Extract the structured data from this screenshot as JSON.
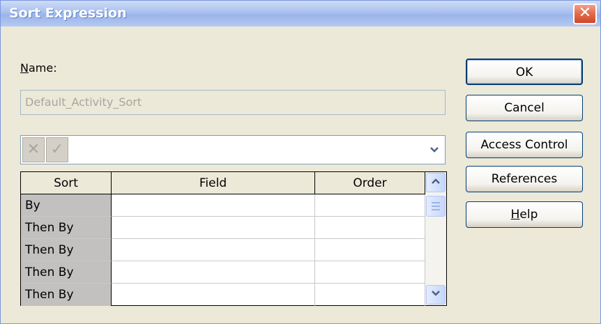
{
  "dialog": {
    "title": "Sort Expression",
    "close_glyph": "✕"
  },
  "name_label": {
    "first_letter": "N",
    "rest": "ame:"
  },
  "name_value": "Default_Activity_Sort",
  "expression_bar": {
    "cancel_icon": "✕",
    "accept_icon": "✓",
    "value": "",
    "dropdown_icon": "chevron-down"
  },
  "grid": {
    "columns": [
      "Sort",
      "Field",
      "Order"
    ],
    "rows": [
      {
        "sort": "By",
        "field": "",
        "order": ""
      },
      {
        "sort": "Then By",
        "field": "",
        "order": ""
      },
      {
        "sort": "Then By",
        "field": "",
        "order": ""
      },
      {
        "sort": "Then By",
        "field": "",
        "order": ""
      },
      {
        "sort": "Then By",
        "field": "",
        "order": ""
      }
    ]
  },
  "buttons": {
    "ok": "OK",
    "cancel": "Cancel",
    "access_control": "Access Control",
    "references": "References",
    "help_first": "H",
    "help_rest": "elp"
  }
}
